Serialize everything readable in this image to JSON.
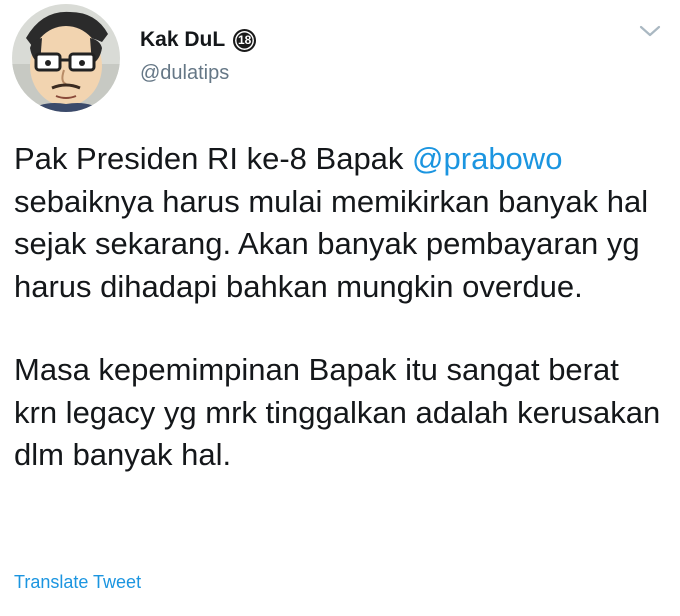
{
  "user": {
    "display_name": "Kak DuL",
    "age_badge": "18",
    "handle": "@dulatips",
    "avatar_icon": "cartoon-glasses-avatar-icon"
  },
  "tweet": {
    "para1_before": "Pak Presiden RI ke-8 Bapak ",
    "mention": "@prabowo",
    "para1_after": " sebaiknya harus mulai memikirkan banyak hal sejak sekarang. Akan banyak pembayaran yg harus dihadapi bahkan mungkin overdue.",
    "para2": "Masa kepemimpinan Bapak itu sangat berat krn legacy yg mrk tinggalkan adalah kerusakan dlm banyak hal."
  },
  "actions": {
    "translate_label": "Translate Tweet",
    "more_icon": "chevron-down-icon"
  },
  "colors": {
    "link": "#1b95e0",
    "text": "#14171a",
    "muted": "#657786"
  }
}
